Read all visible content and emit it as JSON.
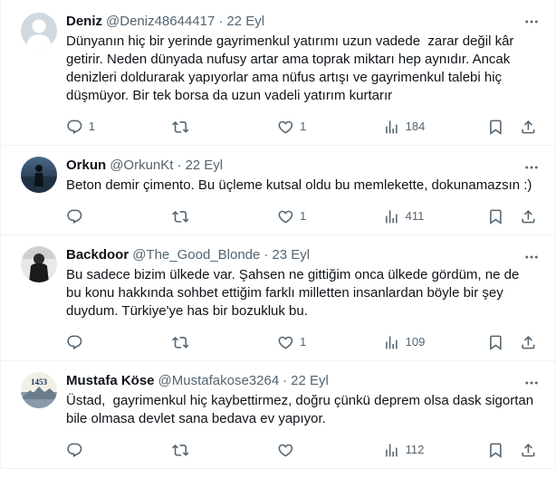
{
  "tweets": [
    {
      "name": "Deniz",
      "handle": "@Deniz48644417",
      "dot": "·",
      "time": "22 Eyl",
      "text": "Dünyanın hiç bir yerinde gayrimenkul yatırımı uzun vadede  zarar değil kâr getirir. Neden dünyada nufusy artar ama toprak miktarı hep aynıdır. Ancak denizleri doldurarak yapıyorlar ama nüfus artışı ve gayrimenkul talebi hiç düşmüyor. Bir tek borsa da uzun vadeli yatırım kurtarır",
      "replies": "1",
      "retweets": "",
      "likes": "1",
      "views": "184",
      "avatar": "default"
    },
    {
      "name": "Orkun",
      "handle": "@OrkunKt",
      "dot": "·",
      "time": "22 Eyl",
      "text": "Beton demir çimento. Bu üçleme kutsal oldu bu memlekette, dokunamazsın :)",
      "replies": "",
      "retweets": "",
      "likes": "1",
      "views": "411",
      "avatar": "orkun"
    },
    {
      "name": "Backdoor",
      "handle": "@The_Good_Blonde",
      "dot": "·",
      "time": "23 Eyl",
      "text": "Bu sadece bizim ülkede var. Şahsen ne gittiğim onca ülkede gördüm, ne de bu konu hakkında sohbet ettiğim farklı milletten insanlardan böyle bir şey duydum. Türkiye'ye has bir bozukluk bu.",
      "replies": "",
      "retweets": "",
      "likes": "1",
      "views": "109",
      "avatar": "backdoor"
    },
    {
      "name": "Mustafa Köse",
      "handle": "@Mustafakose3264",
      "dot": "·",
      "time": "22 Eyl",
      "text": "Üstad,  gayrimenkul hiç kaybettirmez, doğru çünkü deprem olsa dask sigortan bile olmasa devlet sana bedava ev yapıyor.",
      "replies": "",
      "retweets": "",
      "likes": "",
      "views": "112",
      "avatar": "mustafa",
      "avatar_text": "1453"
    }
  ],
  "icons": {
    "reply": "reply-icon",
    "retweet": "retweet-icon",
    "like": "heart-icon",
    "views": "views-icon",
    "bookmark": "bookmark-icon",
    "share": "share-icon",
    "more": "more-icon"
  },
  "colors": {
    "text": "#0f1419",
    "muted": "#536471",
    "border": "#eff3f4"
  }
}
